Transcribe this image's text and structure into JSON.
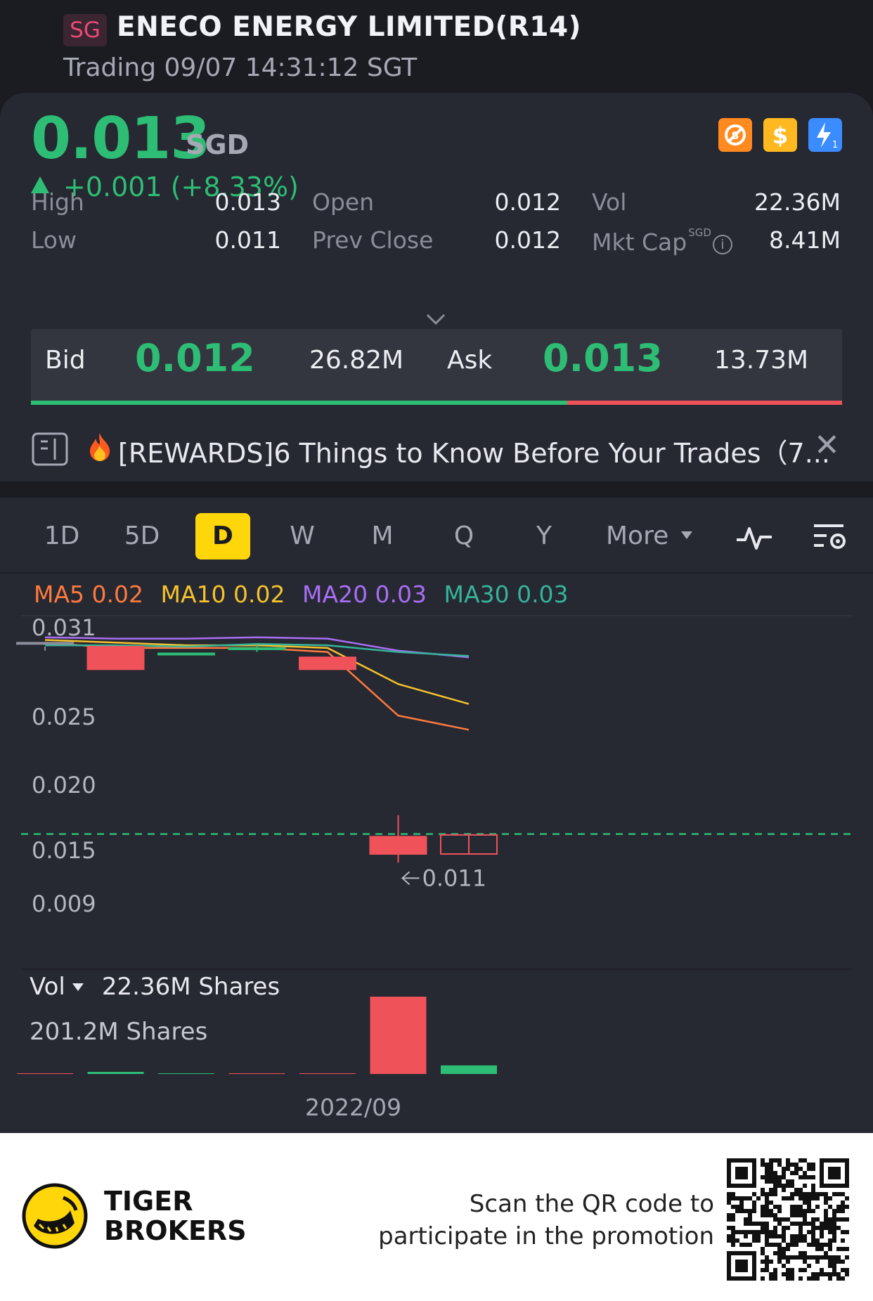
{
  "header": {
    "market": "SG",
    "title": "ENECO ENERGY LIMITED(R14)",
    "status": "Trading 09/07 14:31:12 SGT"
  },
  "quote": {
    "price": "0.013",
    "currency": "SGD",
    "change": "+0.001 (+8.33%)",
    "icons": [
      "no-short-icon",
      "dividend-icon",
      "flash-icon"
    ],
    "stats": {
      "high_label": "High",
      "high": "0.013",
      "low_label": "Low",
      "low": "0.011",
      "open_label": "Open",
      "open": "0.012",
      "prev_close_label": "Prev Close",
      "prev_close": "0.012",
      "vol_label": "Vol",
      "vol": "22.36M",
      "mktcap_label": "Mkt Cap",
      "mktcap_unit": "SGD",
      "mktcap": "8.41M"
    },
    "bid_ask": {
      "bid_label": "Bid",
      "bid_price": "0.012",
      "bid_size": "26.82M",
      "ask_label": "Ask",
      "ask_price": "0.013",
      "ask_size": "13.73M",
      "bid_ratio": 0.661
    }
  },
  "news": {
    "text": "[REWARDS]6 Things to Know Before Your Trades（7..."
  },
  "periods": {
    "items": [
      "1D",
      "5D",
      "D",
      "W",
      "M",
      "Q",
      "Y"
    ],
    "active": "D",
    "more": "More"
  },
  "ma_legend": [
    {
      "label": "MA5 0.02",
      "color": "#ff7a3d"
    },
    {
      "label": "MA10 0.02",
      "color": "#f5c22c"
    },
    {
      "label": "MA20 0.03",
      "color": "#a86ef5"
    },
    {
      "label": "MA30 0.03",
      "color": "#35b49a"
    }
  ],
  "chart_data": {
    "type": "candlestick",
    "y_ticks": [
      "0.031",
      "0.025",
      "0.020",
      "0.015",
      "0.009"
    ],
    "ylim": [
      0.009,
      0.031
    ],
    "candles": [
      {
        "open": 0.0293,
        "close": 0.0293,
        "high": 0.029,
        "low": 0.0287
      },
      {
        "open": 0.029,
        "close": 0.0273,
        "high": 0.029,
        "low": 0.0273
      },
      {
        "open": 0.0285,
        "close": 0.0285,
        "high": 0.0285,
        "low": 0.0285
      },
      {
        "open": 0.0289,
        "close": 0.0289,
        "high": 0.0291,
        "low": 0.0286
      },
      {
        "open": 0.0282,
        "close": 0.0273,
        "high": 0.0282,
        "low": 0.0273
      },
      {
        "open": 0.014,
        "close": 0.012,
        "high": 0.016,
        "low": 0.011
      },
      {
        "open": 0.0142,
        "close": 0.012,
        "high": 0.0142,
        "low": 0.012
      }
    ],
    "ma_series": [
      {
        "name": "MA5",
        "color": "#ff7a3d",
        "values": [
          0.0293,
          0.0289,
          0.0289,
          0.0289,
          0.0286,
          0.0238,
          0.0227
        ]
      },
      {
        "name": "MA10",
        "color": "#f5c22c",
        "values": [
          0.0295,
          0.0293,
          0.0291,
          0.0291,
          0.0289,
          0.0262,
          0.0247
        ]
      },
      {
        "name": "MA20",
        "color": "#a86ef5",
        "values": [
          0.0297,
          0.0296,
          0.0296,
          0.0297,
          0.0296,
          0.0287,
          0.0282
        ]
      },
      {
        "name": "MA30",
        "color": "#35b49a",
        "values": [
          0.0291,
          0.0291,
          0.029,
          0.0292,
          0.0291,
          0.0286,
          0.0283
        ]
      }
    ],
    "last_price_line": 0.0143,
    "low_marker": "0.011",
    "volume": {
      "label": "Vol",
      "current": "22.36M Shares",
      "max_label": "201.2M Shares",
      "max": 201.2,
      "values": [
        0,
        0.3,
        0,
        0,
        0,
        201.2,
        22.36
      ],
      "colors": [
        "red",
        "green",
        "green",
        "red",
        "red",
        "red",
        "green"
      ]
    },
    "x_label": "2022/09"
  },
  "footer": {
    "brand_line1": "TIGER",
    "brand_line2": "BROKERS",
    "promo_line1": "Scan the QR code to",
    "promo_line2": "participate in the promotion"
  }
}
